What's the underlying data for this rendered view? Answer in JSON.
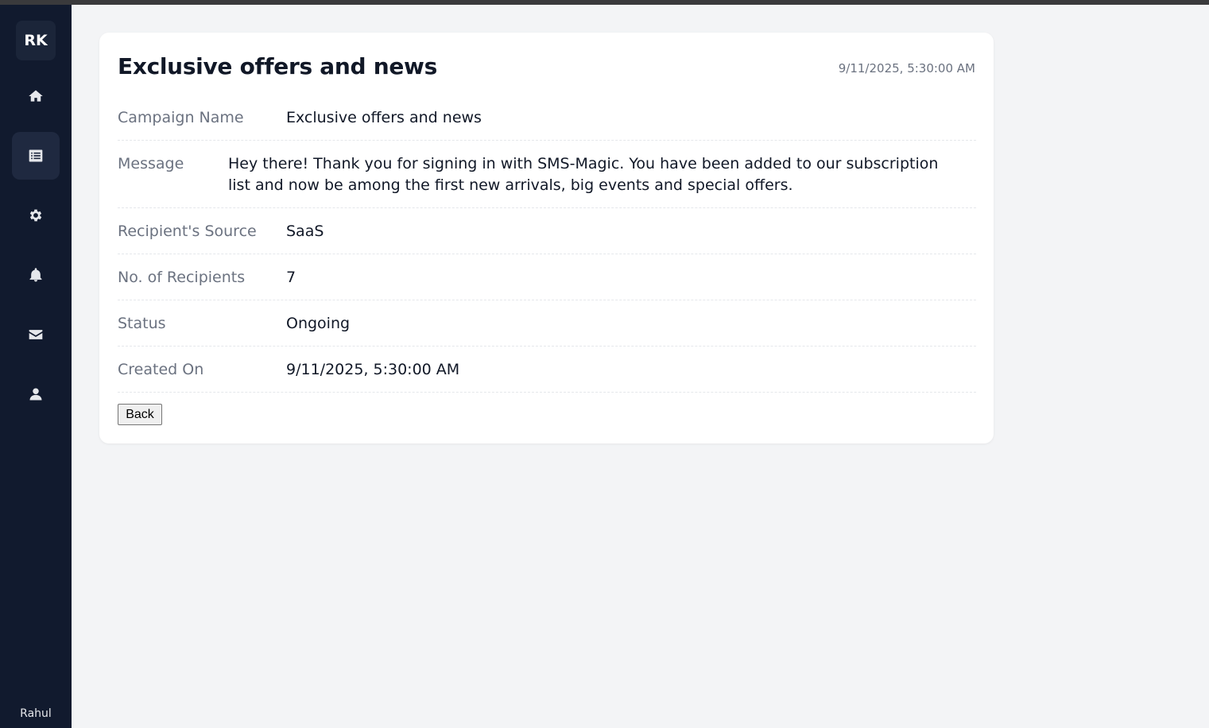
{
  "sidebar": {
    "logo_initials": "RK",
    "items": [
      {
        "icon": "home-icon"
      },
      {
        "icon": "list-icon",
        "active": true
      },
      {
        "icon": "gear-icon"
      },
      {
        "icon": "bell-icon"
      },
      {
        "icon": "envelope-icon"
      },
      {
        "icon": "user-icon"
      }
    ],
    "username": "Rahul"
  },
  "campaign": {
    "title": "Exclusive offers and news",
    "date": "9/11/2025, 5:30:00 AM",
    "fields": {
      "name_label": "Campaign Name",
      "name_value": "Exclusive offers and news",
      "message_label": "Message",
      "message_value": "Hey there! Thank you for signing in with SMS-Magic. You have been added to our subscription list and now be among the first new arrivals, big events and special offers.",
      "source_label": "Recipient's Source",
      "source_value": "SaaS",
      "recipients_label": "No. of Recipients",
      "recipients_value": "7",
      "status_label": "Status",
      "status_value": "Ongoing",
      "created_label": "Created On",
      "created_value": "9/11/2025, 5:30:00 AM"
    },
    "back_label": "Back"
  },
  "colors": {
    "sidebar_bg": "#111a2e",
    "page_bg": "#f3f4f6",
    "card_bg": "#ffffff",
    "label_text": "#6b7280",
    "value_text": "#111827"
  }
}
